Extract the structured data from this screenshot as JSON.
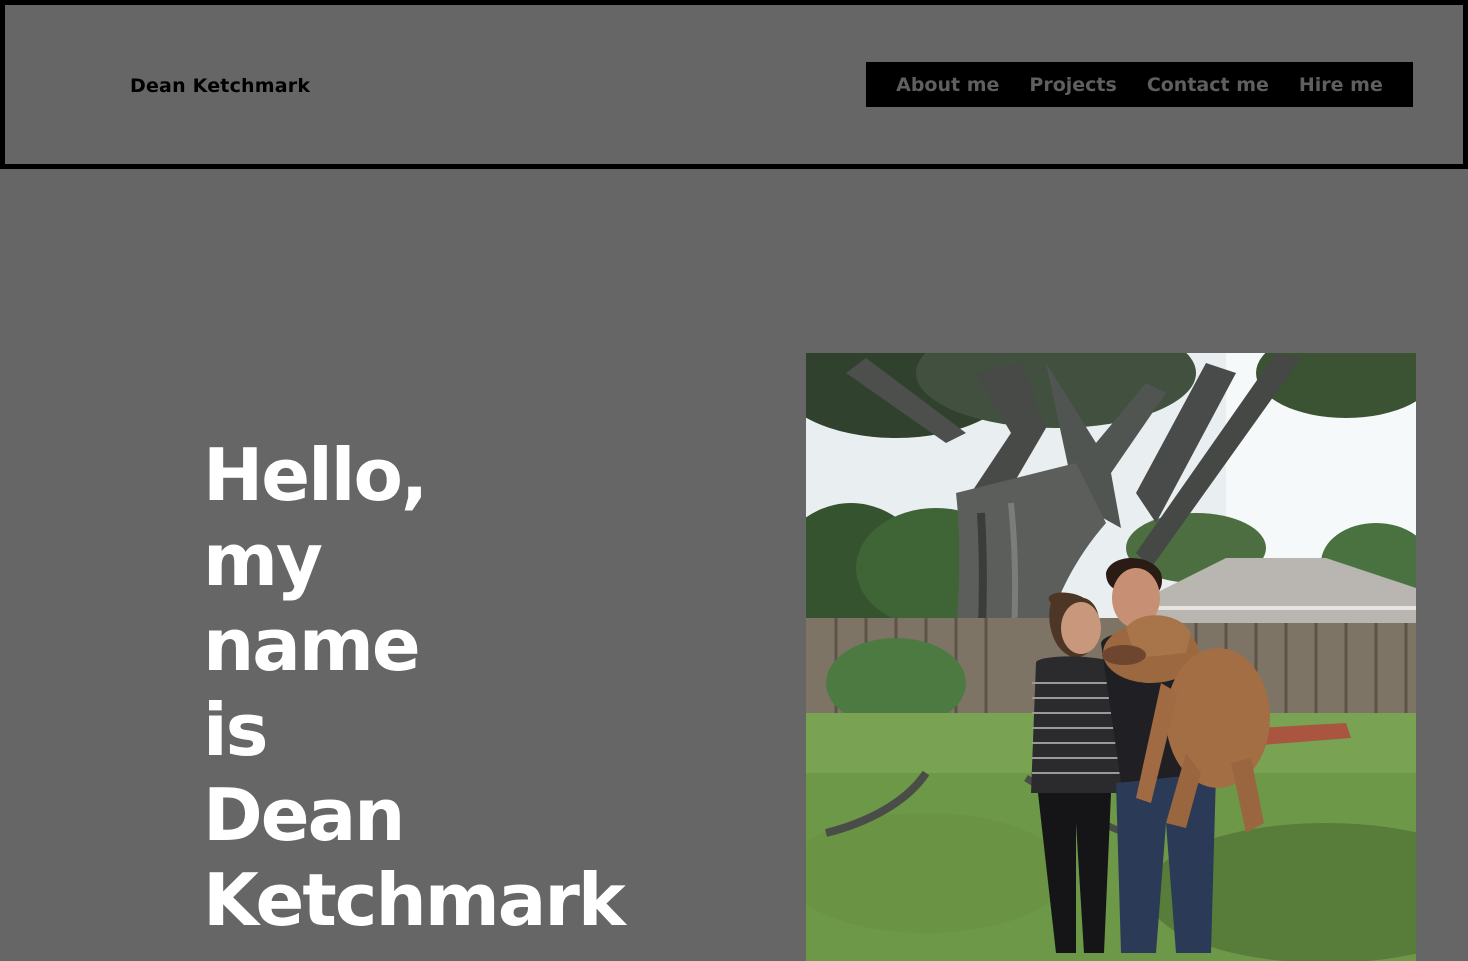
{
  "header": {
    "brand": "Dean Ketchmark",
    "nav": [
      {
        "label": "About me"
      },
      {
        "label": "Projects"
      },
      {
        "label": "Contact me"
      },
      {
        "label": "Hire me"
      }
    ]
  },
  "hero": {
    "lines": [
      "Hello,",
      "my",
      "name",
      "is",
      "Dean",
      "Ketchmark"
    ]
  },
  "colors": {
    "background": "#666666",
    "header_border": "#000000",
    "nav_background": "#000000",
    "nav_text": "#5f5f5f",
    "hero_text": "#ffffff"
  }
}
